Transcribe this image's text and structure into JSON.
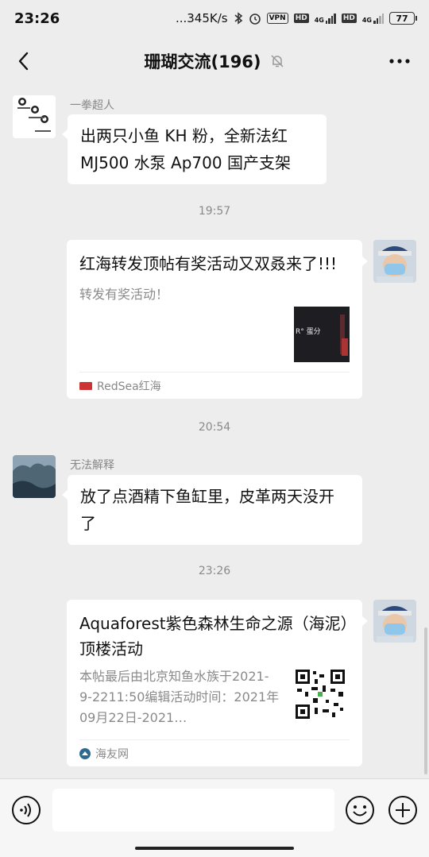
{
  "status_bar": {
    "time": "23:26",
    "network_speed": "...345K/s",
    "vpn": "VPN",
    "hd1": "HD",
    "net1": "4G",
    "hd2": "HD",
    "net2": "4G",
    "battery": "77"
  },
  "header": {
    "title": "珊瑚交流(196)",
    "muted_icon": "bell-off-icon",
    "back_icon": "back-arrow-icon",
    "more_icon": "more-dots-icon"
  },
  "messages": {
    "m1": {
      "sender": "一拳超人",
      "text": "出两只小鱼 KH 粉，全新法红 MJ500 水泵 Ap700 国产支架"
    },
    "t1": "19:57",
    "m2": {
      "title": "红海转发顶帖有奖活动又双叒来了!!!",
      "desc": "转发有奖活动！",
      "source": "RedSea红海",
      "thumb_text": "R° 蛋分"
    },
    "t2": "20:54",
    "m3": {
      "sender": "无法解释",
      "text": "放了点酒精下鱼缸里，皮革两天没开了"
    },
    "t3": "23:26",
    "m4": {
      "title": "Aquaforest紫色森林生命之源（海泥）顶楼活动",
      "desc": "本帖最后由北京知鱼水族于2021-9-2211:50编辑活动时间：2021年09月22日-2021…",
      "source": "海友网"
    }
  },
  "input_bar": {
    "placeholder": "",
    "voice_icon": "voice-icon",
    "emoji_icon": "emoji-icon",
    "plus_icon": "plus-icon"
  },
  "colors": {
    "background": "#ededed",
    "bubble": "#ffffff",
    "meta_text": "#8a8a8a"
  }
}
